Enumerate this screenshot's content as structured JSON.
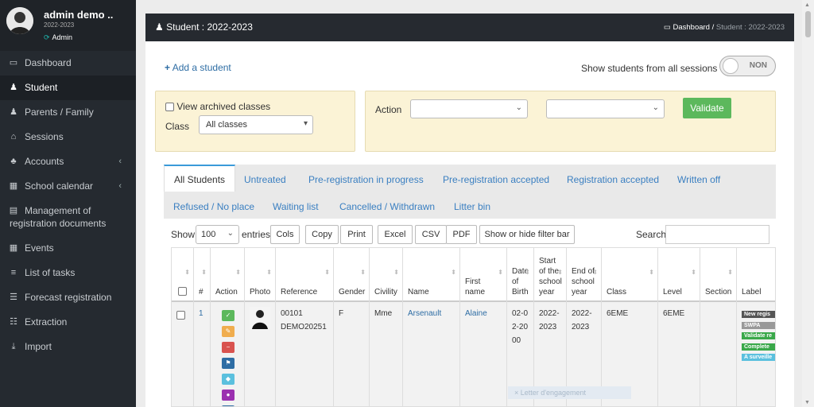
{
  "profile": {
    "name": "admin demo ..",
    "session": "2022-2023",
    "role": "Admin"
  },
  "menu": [
    {
      "label": "Dashboard",
      "icon": "laptop-icon",
      "chev": ""
    },
    {
      "label": "Student",
      "icon": "user-icon",
      "chev": ""
    },
    {
      "label": "Parents / Family",
      "icon": "person-icon",
      "chev": ""
    },
    {
      "label": "Sessions",
      "icon": "home-icon",
      "chev": ""
    },
    {
      "label": "Accounts",
      "icon": "users-icon",
      "chev": "‹"
    },
    {
      "label": "School calendar",
      "icon": "calendar-icon",
      "chev": "‹"
    },
    {
      "label": "Management of",
      "label2": "registration documents",
      "icon": "file-icon"
    },
    {
      "label": "Events",
      "icon": "calendar-icon",
      "chev": ""
    },
    {
      "label": "List of tasks",
      "icon": "list-icon",
      "chev": ""
    },
    {
      "label": "Forecast registration",
      "icon": "list-alt-icon",
      "chev": ""
    },
    {
      "label": "Extraction",
      "icon": "th-list-icon",
      "chev": ""
    },
    {
      "label": "Import",
      "icon": "download-icon",
      "chev": ""
    }
  ],
  "header": {
    "title": "Student : 2022-2023",
    "bc_home": "Dashboard",
    "bc_sep": "/",
    "bc_current": "Student : 2022-2023"
  },
  "add_student": "Add a student",
  "show_all": {
    "label": "Show students from all sessions",
    "toggle": "NON"
  },
  "filter": {
    "archived": "View archived classes",
    "class_label": "Class",
    "class_value": "All classes"
  },
  "action": {
    "label": "Action",
    "select1": "",
    "select2": "",
    "validate": "Validate"
  },
  "tabs": [
    "All Students",
    "Untreated",
    "Pre-registration in progress",
    "Pre-registration accepted",
    "Registration accepted",
    "Written off",
    "Refused / No place",
    "Waiting list",
    "Cancelled / Withdrawn",
    "Litter bin"
  ],
  "controls": {
    "show": "Show",
    "entries_value": "100",
    "entries": "entries",
    "search": "Search:"
  },
  "buttons": [
    "Cols",
    "Copy",
    "Print",
    "Excel",
    "CSV",
    "PDF",
    "Show or hide filter bar"
  ],
  "columns": [
    "#",
    "Action",
    "Photo",
    "Reference",
    "Gender",
    "Civility",
    "Name",
    "First name",
    "Date of Birth",
    "Start of the school year",
    "End of school year",
    "Class",
    "Level",
    "Section",
    "Label"
  ],
  "row": {
    "num": "1",
    "ref1": "00101",
    "ref2": "DEMO20251",
    "gender": "F",
    "civility": "Mme",
    "name": "Arsenault",
    "first": "Alaine",
    "dob": "02-02-2000",
    "start": "2022-2023",
    "end": "2022-2023",
    "class": "6EME",
    "level": "6EME",
    "section": ""
  },
  "labels": [
    "New regis",
    "SWPA",
    "Validate re",
    "Complete",
    "A surveille"
  ],
  "ghost": "Letter d'engagement",
  "colors": {
    "sidebar": "#252a30",
    "accent": "#3a9ad9",
    "green": "#5cb85c"
  }
}
